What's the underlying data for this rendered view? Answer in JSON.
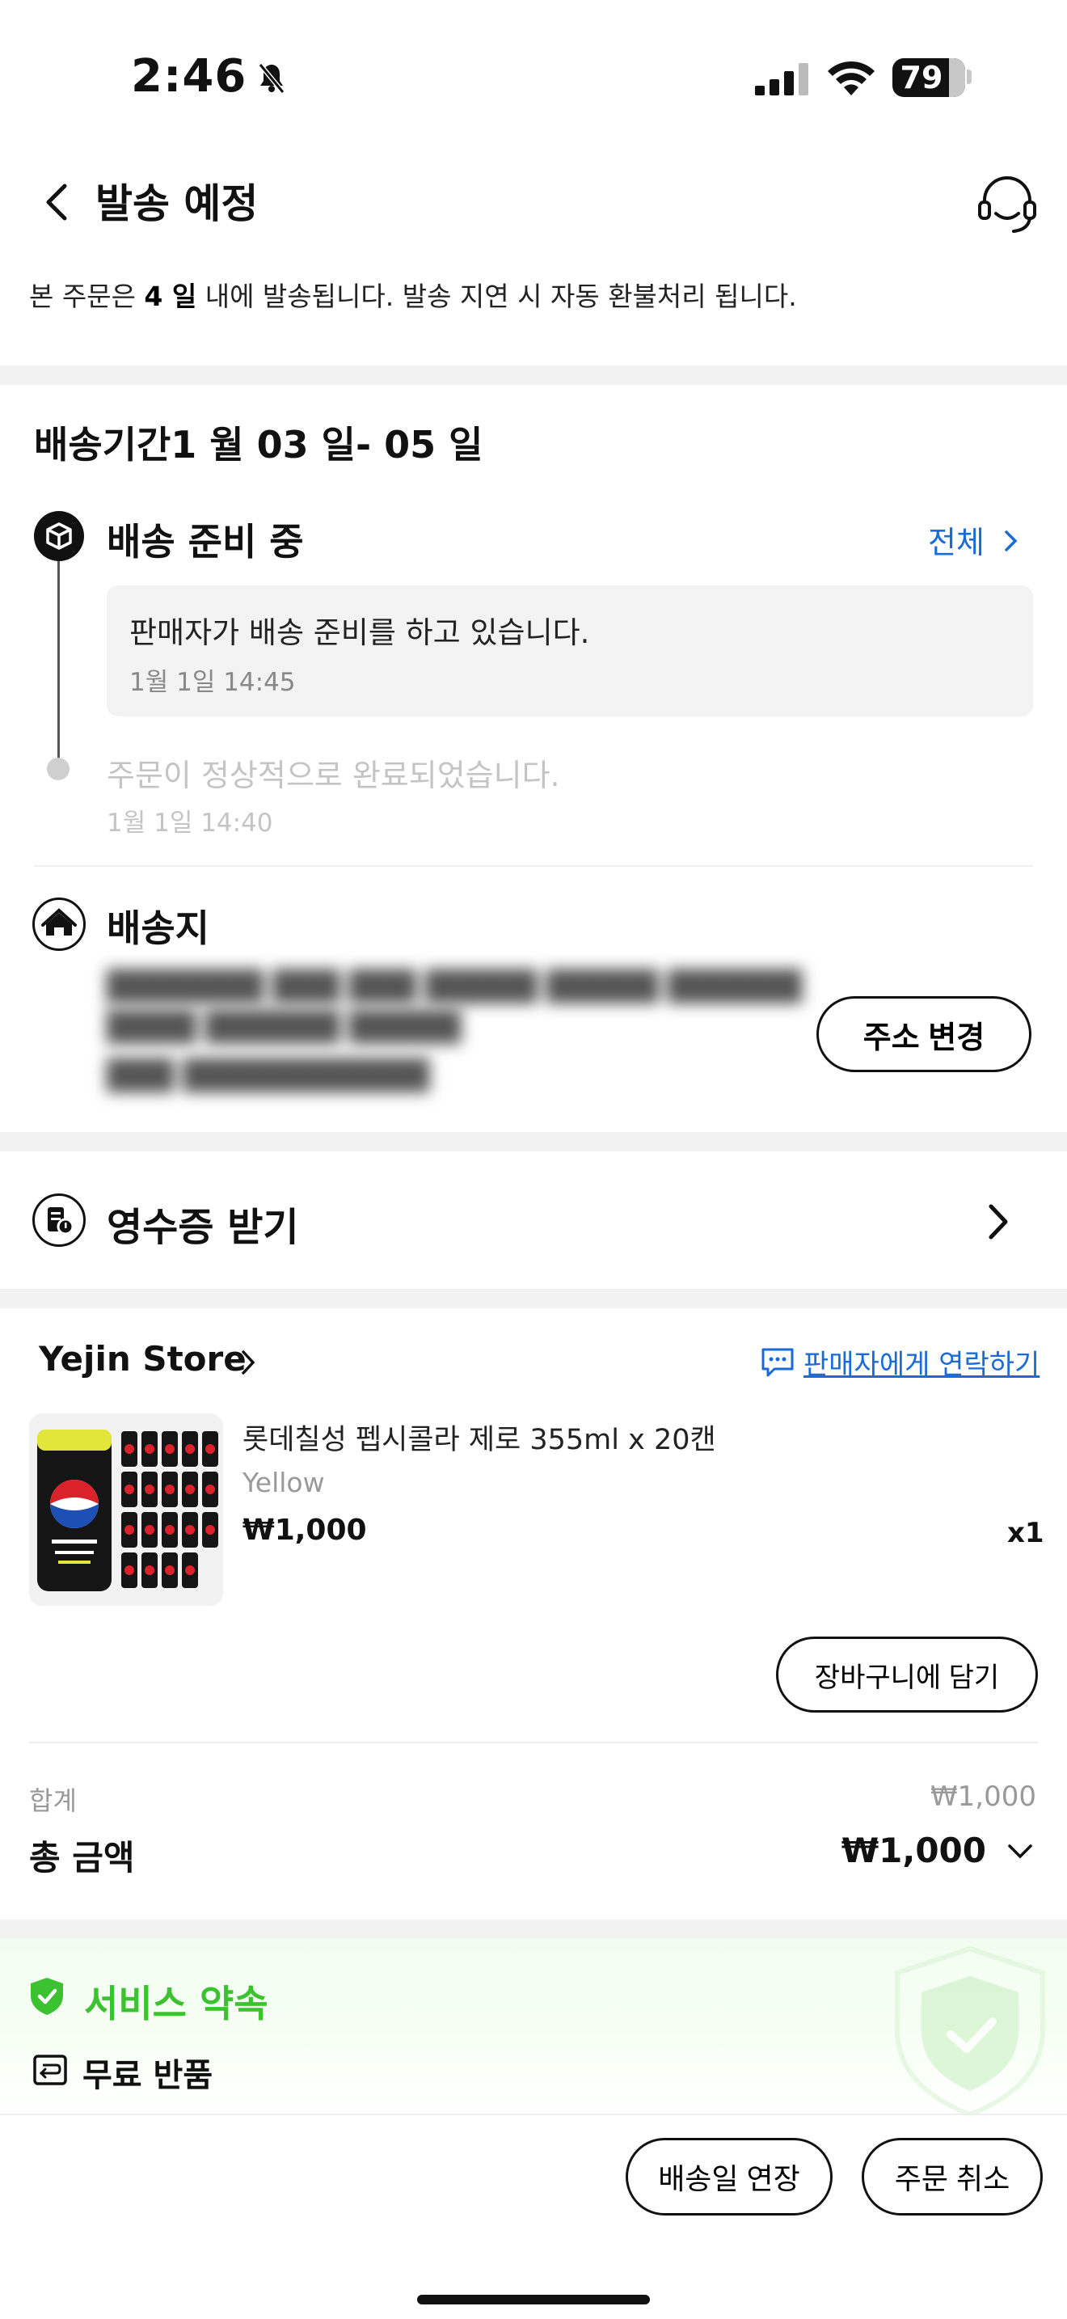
{
  "status_bar": {
    "time": "2:46",
    "battery": "79"
  },
  "header": {
    "title": "발송 예정"
  },
  "notice": {
    "prefix": "본 주문은 ",
    "days": "4 일",
    "suffix": " 내에 발송됩니다. 발송 지연 시 자동 환불처리 됩니다."
  },
  "delivery": {
    "period": "배송기간1 월 03 일- 05 일",
    "view_all": "전체",
    "steps": [
      {
        "title": "배송 준비 중",
        "desc": "판매자가 배송 준비를 하고 있습니다.",
        "time": "1월 1일 14:45"
      },
      {
        "desc": "주문이 정상적으로 완료되었습니다.",
        "time": "1월 1일 14:40"
      }
    ]
  },
  "address": {
    "title": "배송지",
    "change_label": "주소 변경"
  },
  "receipt": {
    "label": "영수증 받기"
  },
  "store": {
    "name": "Yejin Store",
    "contact_label": "판매자에게 연락하기",
    "product": {
      "name": "롯데칠성 펩시콜라 제로 355ml x 20캔",
      "variant": "Yellow",
      "price": "₩1,000",
      "qty": "x1"
    },
    "cart_label": "장바구니에 담기"
  },
  "summary": {
    "subtotal_label": "합계",
    "subtotal_value": "₩1,000",
    "total_label": "총 금액",
    "total_value": "₩1,000"
  },
  "service": {
    "title": "서비스 약속",
    "free_return": "무료 반품"
  },
  "actions": {
    "extend_label": "배송일 연장",
    "cancel_label": "주문 취소"
  },
  "colors": {
    "accent_blue": "#1a6ad8",
    "promise_green": "#3cc130"
  }
}
